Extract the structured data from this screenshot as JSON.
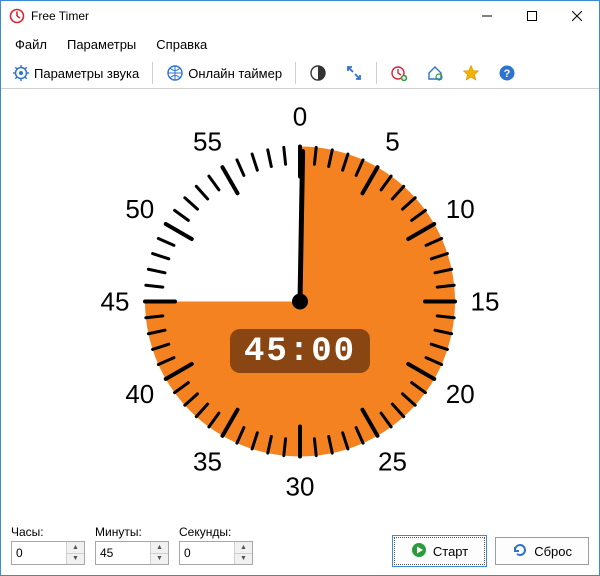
{
  "window": {
    "title": "Free Timer"
  },
  "menu": {
    "file": "Файл",
    "params": "Параметры",
    "help": "Справка"
  },
  "toolbar": {
    "sound_params": "Параметры звука",
    "online_timer": "Онлайн таймер"
  },
  "dial": {
    "numbers": [
      "0",
      "5",
      "10",
      "15",
      "20",
      "25",
      "30",
      "35",
      "40",
      "45",
      "50",
      "55"
    ],
    "minutes_set": 45,
    "digital": "45:00"
  },
  "inputs": {
    "hours_label": "Часы:",
    "hours_value": "0",
    "minutes_label": "Минуты:",
    "minutes_value": "45",
    "seconds_label": "Секунды:",
    "seconds_value": "0"
  },
  "buttons": {
    "start": "Старт",
    "reset": "Сброс"
  },
  "colors": {
    "accent": "#f58220",
    "accent_dark": "#8a4612",
    "blue": "#2e73d0"
  }
}
